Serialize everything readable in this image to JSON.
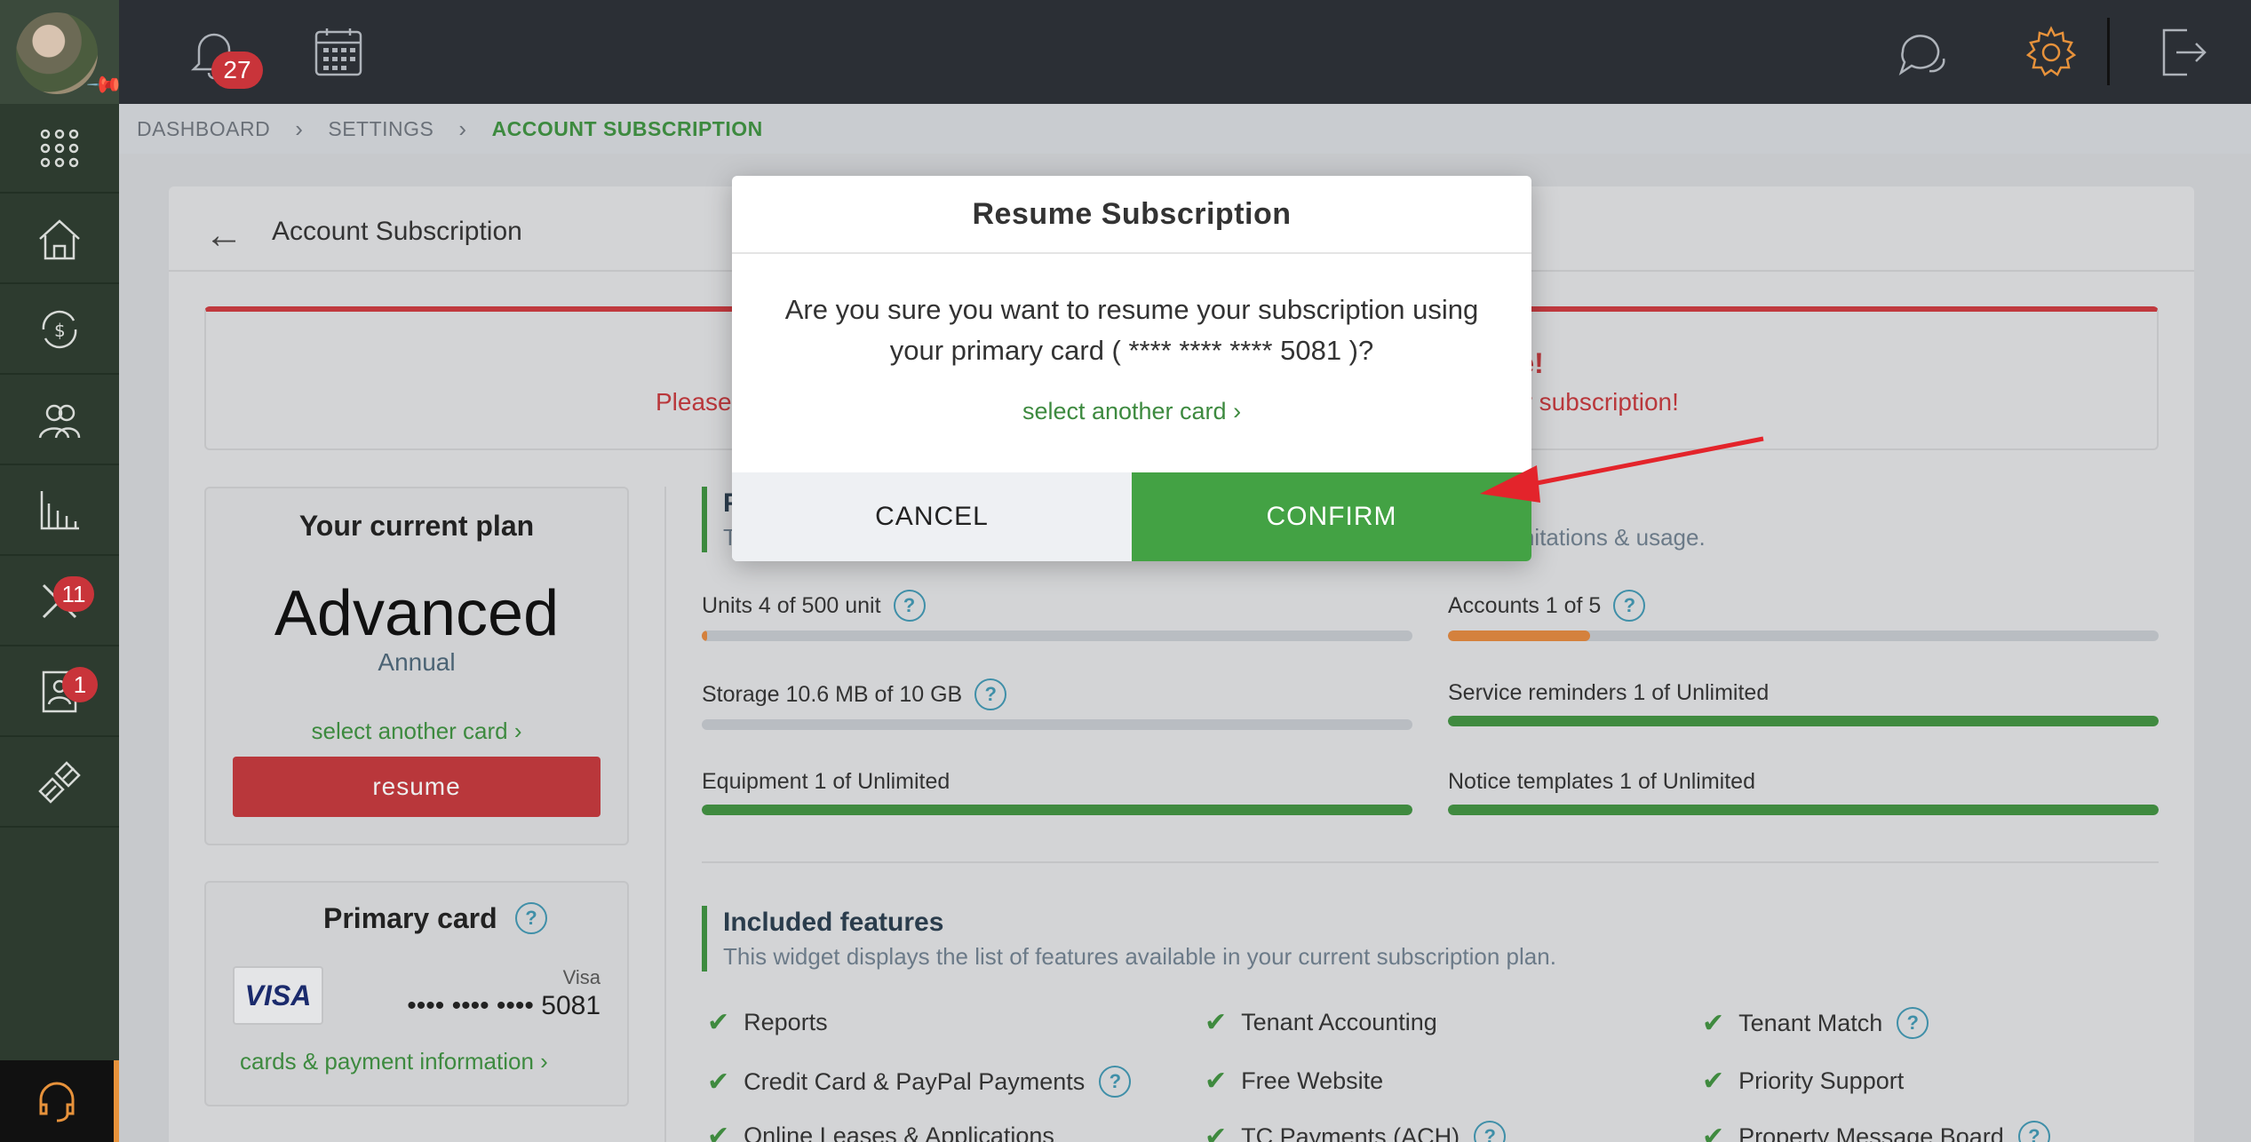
{
  "topbar": {
    "notifications_count": "27"
  },
  "sidebar": {
    "badges": {
      "maintenance": "11",
      "applications": "1"
    }
  },
  "breadcrumb": {
    "items": [
      "DASHBOARD",
      "SETTINGS",
      "ACCOUNT SUBSCRIPTION"
    ],
    "separator": "›"
  },
  "page": {
    "title": "Account Subscription",
    "alert_title": "nce!",
    "alert_text_left": "Please",
    "alert_text_right": "ur subscription!"
  },
  "plan": {
    "heading": "Your current plan",
    "name": "Advanced",
    "period": "Annual",
    "select_card_link": "select another card  ›",
    "resume_label": "resume"
  },
  "primary_card": {
    "heading": "Primary card",
    "help": "?",
    "logo_text": "VISA",
    "brand": "Visa",
    "number": "•••• •••• •••• 5081",
    "payment_link": "cards & payment information  ›"
  },
  "usage_section": {
    "title": "P",
    "desc_left": "T",
    "desc_right": "imitations & usage.",
    "items": [
      {
        "label": "Units 4 of 500 unit",
        "help": "?",
        "fill": 0.008,
        "color": "orange"
      },
      {
        "label": "Accounts 1 of 5",
        "help": "?",
        "fill": 0.2,
        "color": "orange"
      },
      {
        "label": "Storage 10.6 MB of 10 GB",
        "help": "?",
        "fill": 0.001,
        "color": "orange"
      },
      {
        "label": "Service reminders 1 of Unlimited",
        "help": "",
        "fill": 1,
        "color": "green"
      },
      {
        "label": "Equipment 1 of Unlimited",
        "help": "",
        "fill": 1,
        "color": "green"
      },
      {
        "label": "Notice templates 1 of Unlimited",
        "help": "",
        "fill": 1,
        "color": "green"
      }
    ]
  },
  "features_section": {
    "title": "Included features",
    "desc": "This widget displays the list of features available in your current subscription plan.",
    "items": [
      {
        "label": "Reports",
        "help": ""
      },
      {
        "label": "Tenant Accounting",
        "help": ""
      },
      {
        "label": "Tenant Match",
        "help": "?"
      },
      {
        "label": "Credit Card & PayPal Payments",
        "help": "?"
      },
      {
        "label": "Free Website",
        "help": ""
      },
      {
        "label": "Priority Support",
        "help": ""
      },
      {
        "label": "Online Leases & Applications",
        "help": ""
      },
      {
        "label": "TC Payments (ACH)",
        "help": "?"
      },
      {
        "label": "Property Message Board",
        "help": "?"
      }
    ]
  },
  "modal": {
    "title": "Resume Subscription",
    "body": "Are you sure you want to resume your subscription using your primary card ( **** **** **** 5081 )?",
    "select_card_link": "select another card  ›",
    "cancel_label": "CANCEL",
    "confirm_label": "CONFIRM"
  },
  "colors": {
    "accent_green": "#43a244",
    "danger_red": "#b9373b",
    "sidebar_bg": "#2d3b2f",
    "topbar_bg": "#2b2f35"
  }
}
